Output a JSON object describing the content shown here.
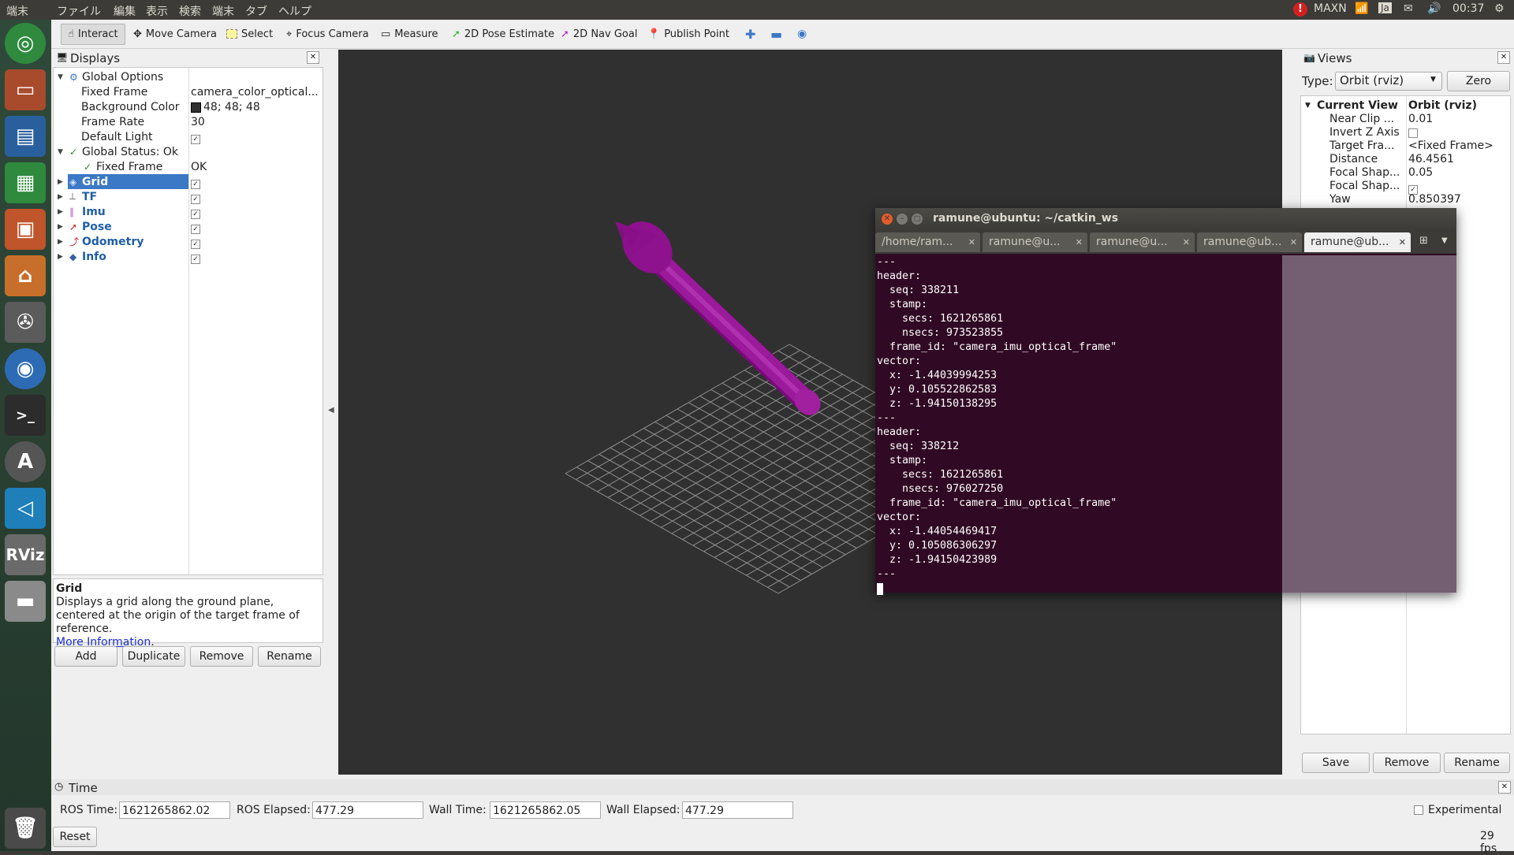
{
  "topbar": {
    "app_name": "端末",
    "menus": [
      "ファイル",
      "編集",
      "表示",
      "検索",
      "端末",
      "タブ",
      "ヘルプ"
    ],
    "power_mode": "MAXN",
    "keyboard": "Ja",
    "clock": "00:37"
  },
  "launcher": {
    "items": [
      "ubuntu-home",
      "files",
      "writer",
      "calc",
      "impress",
      "software-center",
      "system-settings",
      "chromium",
      "terminal",
      "software-updater",
      "vscode",
      "rviz",
      "drive",
      "trash"
    ]
  },
  "toolbar": {
    "tools": [
      "Interact",
      "Move Camera",
      "Select",
      "Focus Camera",
      "Measure",
      "2D Pose Estimate",
      "2D Nav Goal",
      "Publish Point"
    ]
  },
  "displays": {
    "title": "Displays",
    "global_options": "Global Options",
    "fixed_frame_label": "Fixed Frame",
    "fixed_frame_value": "camera_color_optical...",
    "bg_color_label": "Background Color",
    "bg_color_value": "48; 48; 48",
    "frame_rate_label": "Frame Rate",
    "frame_rate_value": "30",
    "default_light_label": "Default Light",
    "global_status_label": "Global Status: Ok",
    "status_fixed_frame_label": "Fixed Frame",
    "status_fixed_frame_value": "OK",
    "items": [
      "Grid",
      "TF",
      "Imu",
      "Pose",
      "Odometry",
      "Info"
    ],
    "desc_title": "Grid",
    "desc_text": "Displays a grid along the ground plane, centered at the origin of the target frame of reference.",
    "desc_link": "More Information",
    "desc_period": ".",
    "buttons": {
      "add": "Add",
      "duplicate": "Duplicate",
      "remove": "Remove",
      "rename": "Rename"
    }
  },
  "terminal": {
    "title": "ramune@ubuntu: ~/catkin_ws",
    "tabs": [
      "/home/ram...",
      "ramune@u...",
      "ramune@u...",
      "ramune@ub...",
      "ramune@ub..."
    ],
    "lines": [
      "---",
      "header:",
      "  seq: 338211",
      "  stamp:",
      "    secs: 1621265861",
      "    nsecs: 973523855",
      "  frame_id: \"camera_imu_optical_frame\"",
      "vector:",
      "  x: -1.44039994253",
      "  y: 0.105522862583",
      "  z: -1.94150138295",
      "---",
      "header:",
      "  seq: 338212",
      "  stamp:",
      "    secs: 1621265861",
      "    nsecs: 976027250",
      "  frame_id: \"camera_imu_optical_frame\"",
      "vector:",
      "  x: -1.44054469417",
      "  y: 0.105086306297",
      "  z: -1.94150423989",
      "---"
    ]
  },
  "views": {
    "title": "Views",
    "type_label": "Type:",
    "type_value": "Orbit (rviz)",
    "zero": "Zero",
    "current_view": "Current View",
    "current_view_value": "Orbit (rviz)",
    "props": [
      {
        "k": "Near Clip ...",
        "v": "0.01"
      },
      {
        "k": "Invert Z Axis",
        "v": ""
      },
      {
        "k": "Target Fra...",
        "v": "<Fixed Frame>"
      },
      {
        "k": "Distance",
        "v": "46.4561"
      },
      {
        "k": "Focal Shap...",
        "v": "0.05"
      },
      {
        "k": "Focal Shap...",
        "v": ""
      },
      {
        "k": "Yaw",
        "v": "0.850397"
      }
    ],
    "buttons": {
      "save": "Save",
      "remove": "Remove",
      "rename": "Rename"
    }
  },
  "time": {
    "title": "Time",
    "ros_time_label": "ROS Time:",
    "ros_time": "1621265862.02",
    "ros_elapsed_label": "ROS Elapsed:",
    "ros_elapsed": "477.29",
    "wall_time_label": "Wall Time:",
    "wall_time": "1621265862.05",
    "wall_elapsed_label": "Wall Elapsed:",
    "wall_elapsed": "477.29",
    "experimental": "Experimental",
    "reset": "Reset",
    "fps": "29 fps"
  },
  "colors": {
    "arrow": "#8b008b",
    "terminal_bg": "#300a24",
    "viewport_bg": "#303030",
    "selection": "#3b78c6"
  }
}
